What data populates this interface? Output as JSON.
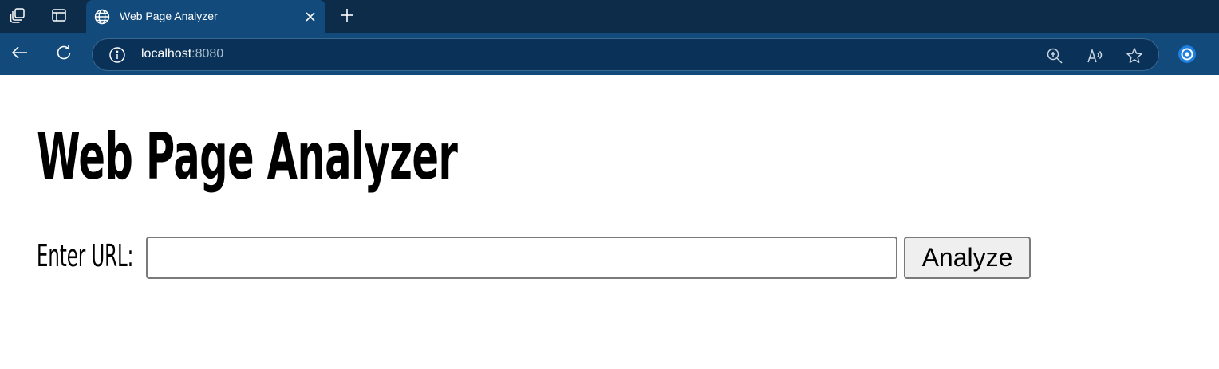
{
  "browser": {
    "tab": {
      "title": "Web Page Analyzer"
    },
    "address": {
      "host": "localhost",
      "port": ":8080"
    },
    "icons": {
      "workspaces": "workspaces-icon",
      "tab_actions": "tab-actions-icon",
      "favicon": "globe-icon",
      "close": "close-icon",
      "new_tab": "plus-icon",
      "back": "back-arrow-icon",
      "reload": "reload-icon",
      "info": "info-icon",
      "zoom": "zoom-icon",
      "read_aloud": "read-aloud-icon",
      "favorite": "star-icon",
      "profile": "copilot-icon"
    },
    "colors": {
      "tabbar": "#0c2c4a",
      "toolbar": "#114a7b",
      "address_bg": "#0a3157"
    }
  },
  "page": {
    "title": "Web Page Analyzer",
    "url_label": "Enter URL:",
    "url_input": {
      "value": "",
      "placeholder": ""
    },
    "analyze_button": "Analyze"
  }
}
